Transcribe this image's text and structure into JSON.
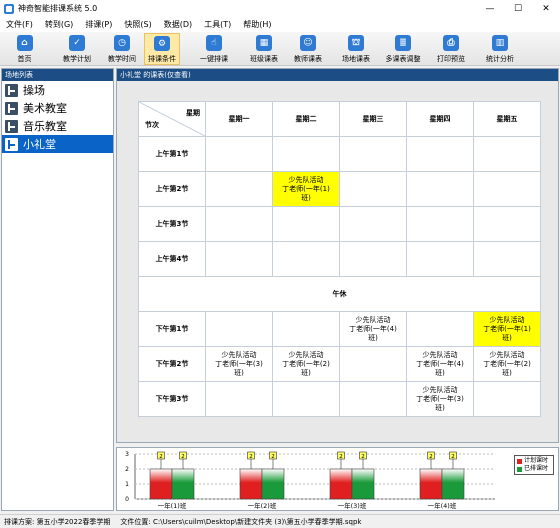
{
  "window": {
    "title": "神奇智能排课系统 5.0",
    "min": "—",
    "max": "☐",
    "close": "✕"
  },
  "menu": [
    "文件(F)",
    "转到(G)",
    "排课(P)",
    "快照(S)",
    "数据(D)",
    "工具(T)",
    "帮助(H)"
  ],
  "toolbar": [
    {
      "label": "首页",
      "icon": "home-icon",
      "color": "#2f7bd3",
      "glyph": "⌂"
    },
    {
      "label": "教学计划",
      "icon": "clipboard-icon",
      "color": "#2f7bd3",
      "glyph": "✓"
    },
    {
      "label": "教学时间",
      "icon": "clock-icon",
      "color": "#2f7bd3",
      "glyph": "◷"
    },
    {
      "label": "排课条件",
      "icon": "settings-icon",
      "color": "#2f7bd3",
      "glyph": "⚙"
    },
    {
      "label": "一键排课",
      "icon": "click-icon",
      "color": "#2f7bd3",
      "glyph": "☝"
    },
    {
      "label": "班级课表",
      "icon": "class-table-icon",
      "color": "#2f7bd3",
      "glyph": "▦"
    },
    {
      "label": "教师课表",
      "icon": "teacher-icon",
      "color": "#2f7bd3",
      "glyph": "☺"
    },
    {
      "label": "场地课表",
      "icon": "venue-icon",
      "color": "#2f7bd3",
      "glyph": "⛫"
    },
    {
      "label": "多课表调整",
      "icon": "adjust-icon",
      "color": "#2f7bd3",
      "glyph": "≣"
    },
    {
      "label": "打印预览",
      "icon": "print-icon",
      "color": "#2f7bd3",
      "glyph": "⎙"
    },
    {
      "label": "统计分析",
      "icon": "stats-icon",
      "color": "#2f7bd3",
      "glyph": "▥"
    }
  ],
  "sidebar": {
    "header": "场地列表",
    "items": [
      "操场",
      "美术教室",
      "音乐教室",
      "小礼堂"
    ],
    "selected_index": 3
  },
  "main": {
    "header": "小礼堂 的课表(仅查看)",
    "corner_top": "星期",
    "corner_bottom": "节次",
    "days": [
      "星期一",
      "星期二",
      "星期三",
      "星期四",
      "星期五"
    ],
    "noon_label": "午休",
    "morning": [
      {
        "period": "上午第1节",
        "cells": [
          "",
          "",
          "",
          "",
          ""
        ]
      },
      {
        "period": "上午第2节",
        "cells": [
          "",
          "少先队活动\n丁老师(一年(1)\n班)",
          "",
          "",
          ""
        ]
      },
      {
        "period": "上午第3节",
        "cells": [
          "",
          "",
          "",
          "",
          ""
        ]
      },
      {
        "period": "上午第4节",
        "cells": [
          "",
          "",
          "",
          "",
          ""
        ]
      }
    ],
    "afternoon": [
      {
        "period": "下午第1节",
        "cells": [
          "",
          "",
          "少先队活动\n丁老师(一年(4)\n班)",
          "",
          "少先队活动\n丁老师(一年(1)\n班)"
        ]
      },
      {
        "period": "下午第2节",
        "cells": [
          "少先队活动\n丁老师(一年(3)\n班)",
          "少先队活动\n丁老师(一年(2)\n班)",
          "",
          "少先队活动\n丁老师(一年(4)\n班)",
          "少先队活动\n丁老师(一年(2)\n班)"
        ]
      },
      {
        "period": "下午第3节",
        "cells": [
          "",
          "",
          "",
          "少先队活动\n丁老师(一年(3)\n班)",
          ""
        ]
      }
    ],
    "highlight_color": "#ffff00"
  },
  "chart_data": {
    "type": "bar",
    "categories": [
      "一年(1)班",
      "一年(2)班",
      "一年(3)班",
      "一年(4)班"
    ],
    "series": [
      {
        "name": "计划课时",
        "color": "#e02020",
        "values": [
          2,
          2,
          2,
          2
        ]
      },
      {
        "name": "已排课时",
        "color": "#1a9a3a",
        "values": [
          2,
          2,
          2,
          2
        ]
      }
    ],
    "data_labels": [
      "2",
      "2",
      "2",
      "2",
      "2",
      "2",
      "2",
      "2"
    ],
    "ylim": [
      0,
      3
    ],
    "yticks": [
      "0",
      "1",
      "2",
      "3"
    ]
  },
  "status": {
    "plan": "排课方案:  第五小学2022春季学期",
    "file": "文件位置:  C:\\Users\\cuilm\\Desktop\\新建文件夹 (3)\\第五小学春季学期.sqpk"
  }
}
